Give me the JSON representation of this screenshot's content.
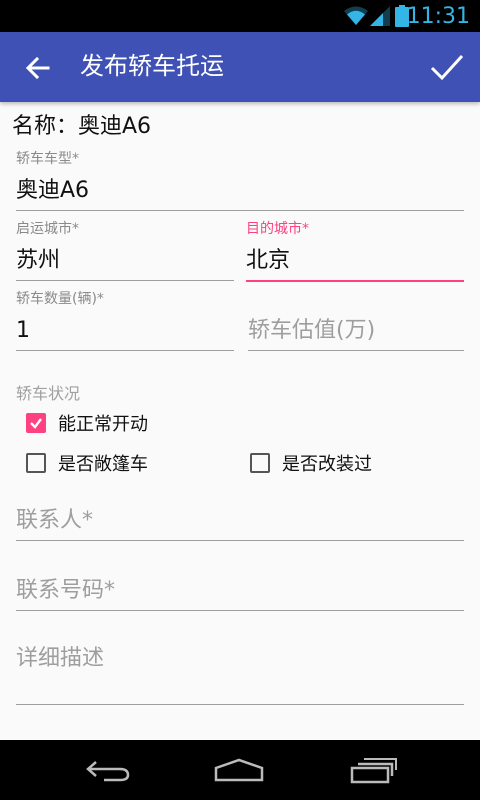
{
  "status_bar": {
    "time": "11:31"
  },
  "app_bar": {
    "title": "发布轿车托运"
  },
  "form": {
    "name_line": "名称：奥迪A6",
    "car_model": {
      "label": "轿车车型*",
      "value": "奥迪A6"
    },
    "origin_city": {
      "label": "启运城市*",
      "value": "苏州"
    },
    "dest_city": {
      "label": "目的城市*",
      "value": "北京"
    },
    "quantity": {
      "label": "轿车数量(辆)*",
      "value": "1"
    },
    "valuation": {
      "placeholder": "轿车估值(万)"
    },
    "condition": {
      "label": "轿车状况",
      "can_start": {
        "label": "能正常开动",
        "checked": true
      },
      "is_convertible": {
        "label": "是否敞篷车",
        "checked": false
      },
      "is_modified": {
        "label": "是否改装过",
        "checked": false
      }
    },
    "contact_name": {
      "placeholder": "联系人*"
    },
    "contact_phone": {
      "placeholder": "联系号码*"
    },
    "description": {
      "placeholder": "详细描述"
    }
  },
  "colors": {
    "primary": "#3f51b5",
    "accent": "#ff4081",
    "status_icons": "#33b5e5"
  }
}
